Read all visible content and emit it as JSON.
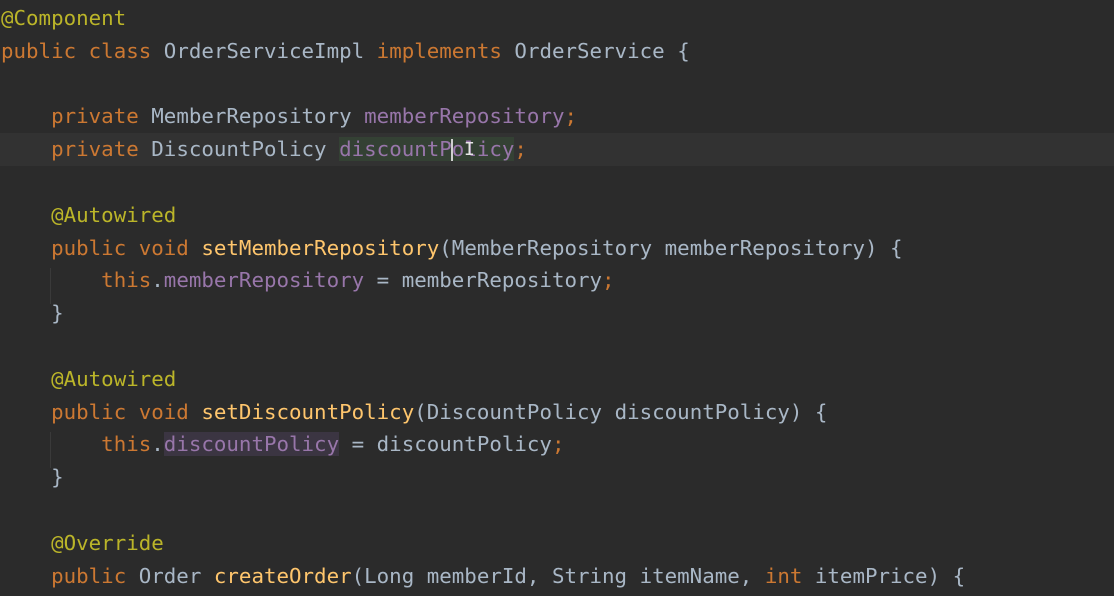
{
  "editor": {
    "language": "java",
    "cursor_line": 5,
    "colors": {
      "background": "#2b2b2b",
      "keyword": "#cc7832",
      "annotation": "#bbb529",
      "field": "#9876aa",
      "method": "#ffc66d",
      "text": "#a9b7c6"
    },
    "lines": {
      "l1": {
        "ann": "@Component"
      },
      "l2": {
        "kw1": "public",
        "kw2": "class",
        "name": "OrderServiceImpl",
        "kw3": "implements",
        "iface": "OrderService",
        "brace": "{"
      },
      "l4": {
        "kw": "private",
        "type": "MemberRepository",
        "field": "memberRepository",
        "semi": ";"
      },
      "l5": {
        "kw": "private",
        "type": "DiscountPolicy",
        "field_a": "discountP",
        "field_b": "olicy",
        "semi": ";"
      },
      "l7": {
        "ann": "@Autowired"
      },
      "l8": {
        "kw1": "public",
        "kw2": "void",
        "method": "setMemberRepository",
        "params": "(MemberRepository memberRepository) {"
      },
      "l9": {
        "kw": "this",
        "dot": ".",
        "field": "memberRepository",
        "rest": " = memberRepository",
        "semi": ";"
      },
      "l10": {
        "brace": "}"
      },
      "l12": {
        "ann": "@Autowired"
      },
      "l13": {
        "kw1": "public",
        "kw2": "void",
        "method": "setDiscountPolicy",
        "params": "(DiscountPolicy discountPolicy) {"
      },
      "l14": {
        "kw": "this",
        "dot": ".",
        "field": "discountPolicy",
        "rest": " = discountPolicy",
        "semi": ";"
      },
      "l15": {
        "brace": "}"
      },
      "l17": {
        "ann": "@Override"
      },
      "l18": {
        "kw1": "public",
        "type": "Order",
        "method": "createOrder",
        "p1": "(Long memberId, String itemName, ",
        "kw2": "int",
        "p2": " itemPrice) {"
      }
    }
  }
}
